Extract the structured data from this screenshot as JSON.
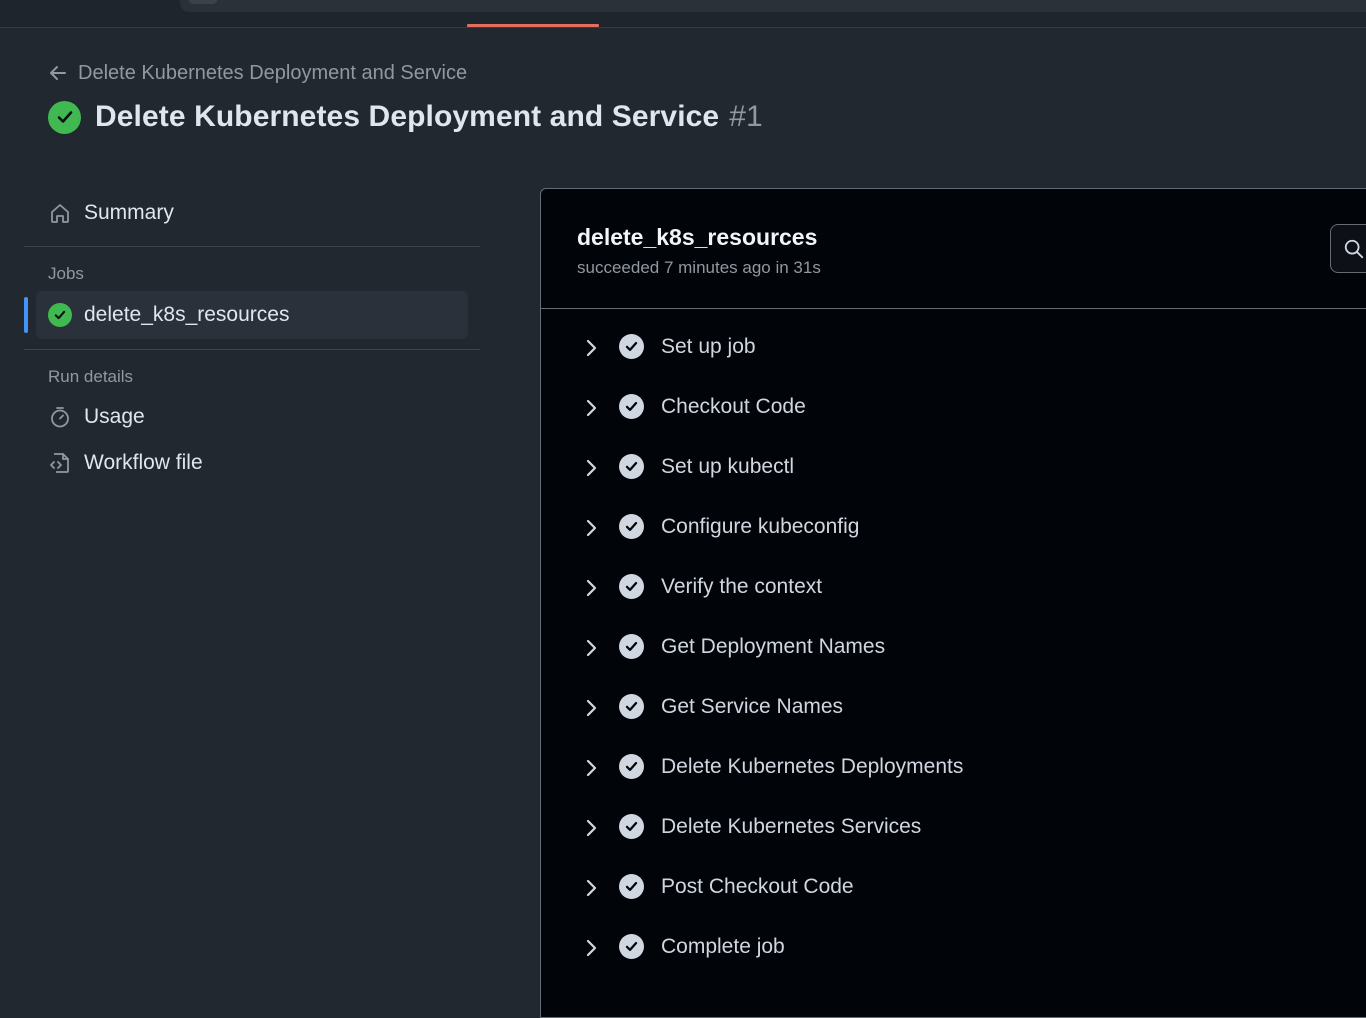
{
  "header": {
    "back_label": "Delete Kubernetes Deployment and Service",
    "title": "Delete Kubernetes Deployment and Service",
    "run_number": "#1"
  },
  "sidebar": {
    "summary_label": "Summary",
    "jobs_heading": "Jobs",
    "job_label": "delete_k8s_resources",
    "run_details_heading": "Run details",
    "usage_label": "Usage",
    "workflow_file_label": "Workflow file"
  },
  "job": {
    "name": "delete_k8s_resources",
    "status": "succeeded 7 minutes ago in 31s"
  },
  "steps": [
    "Set up job",
    "Checkout Code",
    "Set up kubectl",
    "Configure kubeconfig",
    "Verify the context",
    "Get Deployment Names",
    "Get Service Names",
    "Delete Kubernetes Deployments",
    "Delete Kubernetes Services",
    "Post Checkout Code",
    "Complete job"
  ],
  "colors": {
    "success": "#3fb950",
    "accent": "#4493f8",
    "background": "#212830",
    "panel": "#010409"
  }
}
